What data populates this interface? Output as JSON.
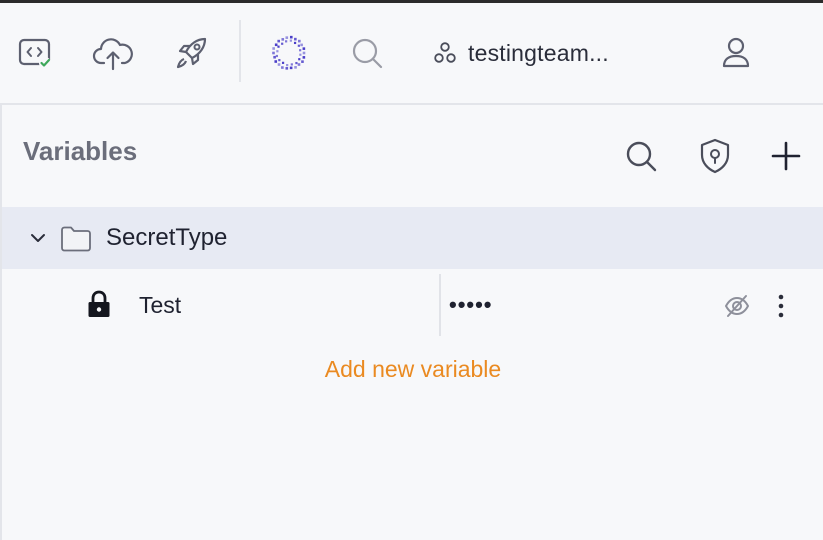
{
  "toolbar": {
    "icons": [
      "code-check-icon",
      "cloud-upload-icon",
      "rocket-icon",
      "team-logo-icon",
      "search-icon"
    ],
    "workspace": {
      "icon": "group-icon",
      "name": "testingteam..."
    },
    "profile_icon": "user-icon"
  },
  "panel": {
    "title": "Variables",
    "actions": [
      "search-icon",
      "shield-keyhole-icon",
      "plus-icon"
    ]
  },
  "tree": {
    "folder": {
      "name": "SecretType",
      "expanded": true,
      "variables": [
        {
          "name": "Test",
          "value": "•••••",
          "type": "secret",
          "value_hidden": true
        }
      ]
    }
  },
  "add_variable_label": "Add new variable",
  "colors": {
    "accent": "#ea8a21",
    "selected_row": "#e7eaf3",
    "background": "#f7f8fa",
    "brand": "#4b3fc9"
  }
}
